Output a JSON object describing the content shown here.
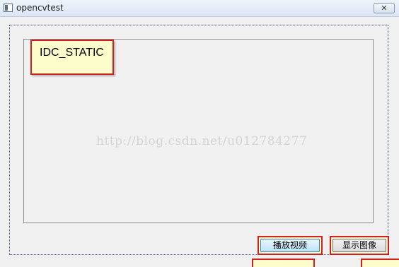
{
  "window": {
    "title": "opencvtest",
    "close_glyph": "✕"
  },
  "picture_control": {
    "label": "IDC_STATIC"
  },
  "watermark": {
    "text": "http://blog.csdn.net/u012784277"
  },
  "buttons": {
    "play_video": "播放视频",
    "show_image": "显示图像"
  },
  "colors": {
    "highlight_border": "#d31f1f",
    "highlight_fill": "#fdfdcc"
  },
  "icons": {
    "app": "app-icon",
    "close": "close-icon"
  }
}
